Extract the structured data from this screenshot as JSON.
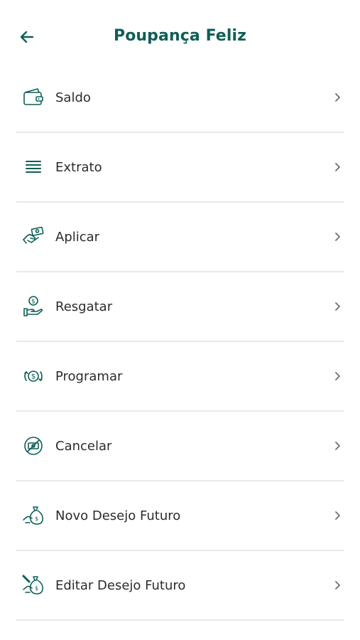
{
  "header": {
    "title": "Poupança Feliz",
    "back_icon": "arrow-left-icon"
  },
  "colors": {
    "brand": "#0f5f56",
    "text": "#2c2c2c",
    "divider": "#e9e9e9",
    "chevron": "#6f6f6f"
  },
  "menu": {
    "items": [
      {
        "label": "Saldo",
        "icon": "wallet-icon"
      },
      {
        "label": "Extrato",
        "icon": "list-lines-icon"
      },
      {
        "label": "Aplicar",
        "icon": "hand-money-icon"
      },
      {
        "label": "Resgatar",
        "icon": "hand-coin-icon"
      },
      {
        "label": "Programar",
        "icon": "coin-cycle-icon"
      },
      {
        "label": "Cancelar",
        "icon": "cancel-money-icon"
      },
      {
        "label": "Novo Desejo Futuro",
        "icon": "money-bag-icon"
      },
      {
        "label": "Editar Desejo Futuro",
        "icon": "edit-money-bag-icon"
      }
    ]
  }
}
